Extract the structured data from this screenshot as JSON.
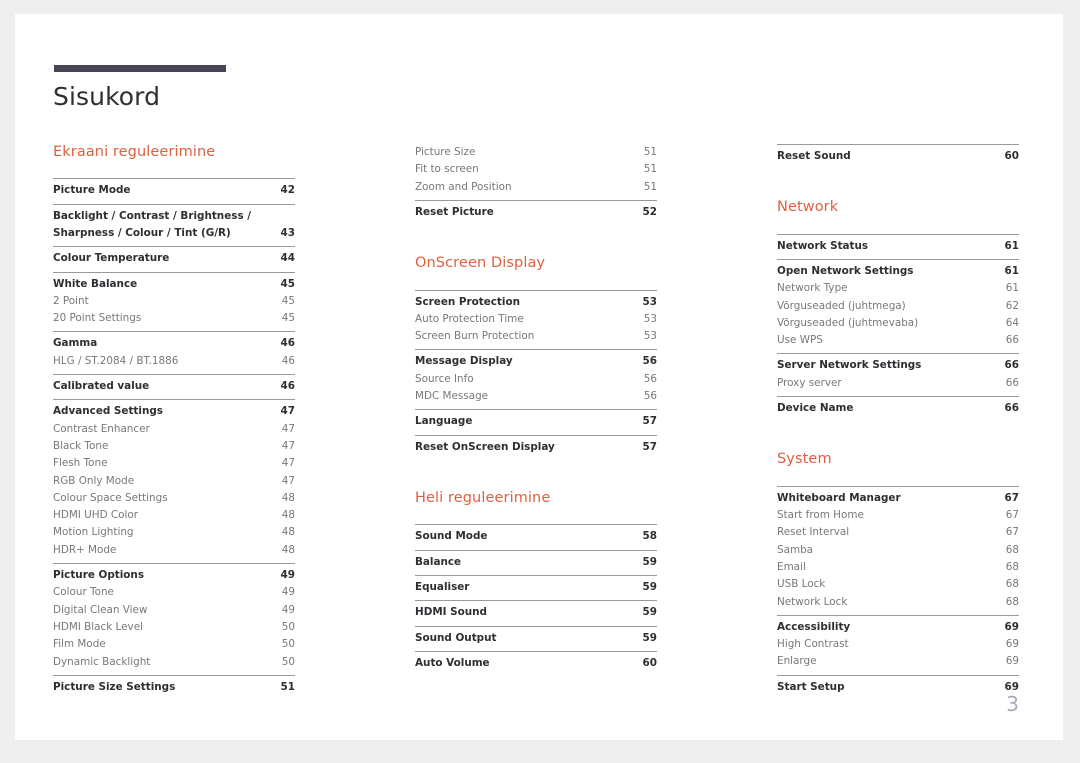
{
  "document": {
    "title": "Sisukord",
    "page_number": "3",
    "accent_color": "#df6040",
    "rule_color": "#474456"
  },
  "columns": [
    {
      "name": "column-1",
      "blocks": [
        {
          "type": "section",
          "heading": "Ekraani reguleerimine"
        },
        {
          "type": "group",
          "rule": true,
          "rows": [
            {
              "label": "Picture Mode",
              "page": "42",
              "level": "main"
            }
          ]
        },
        {
          "type": "group",
          "rule": true,
          "rows": [
            {
              "label": "Backlight / Contrast / Brightness / Sharpness / Colour / Tint (G/R)",
              "page": "43",
              "level": "main",
              "multiline": true
            }
          ]
        },
        {
          "type": "group",
          "rule": true,
          "rows": [
            {
              "label": "Colour Temperature",
              "page": "44",
              "level": "main"
            }
          ]
        },
        {
          "type": "group",
          "rule": true,
          "rows": [
            {
              "label": "White Balance",
              "page": "45",
              "level": "main"
            },
            {
              "label": "2 Point",
              "page": "45",
              "level": "sub"
            },
            {
              "label": "20 Point Settings",
              "page": "45",
              "level": "sub"
            }
          ]
        },
        {
          "type": "group",
          "rule": true,
          "rows": [
            {
              "label": "Gamma",
              "page": "46",
              "level": "main"
            },
            {
              "label": "HLG / ST.2084 / BT.1886",
              "page": "46",
              "level": "sub"
            }
          ]
        },
        {
          "type": "group",
          "rule": true,
          "rows": [
            {
              "label": "Calibrated value",
              "page": "46",
              "level": "main"
            }
          ]
        },
        {
          "type": "group",
          "rule": true,
          "rows": [
            {
              "label": "Advanced Settings",
              "page": "47",
              "level": "main"
            },
            {
              "label": "Contrast Enhancer",
              "page": "47",
              "level": "sub"
            },
            {
              "label": "Black Tone",
              "page": "47",
              "level": "sub"
            },
            {
              "label": "Flesh Tone",
              "page": "47",
              "level": "sub"
            },
            {
              "label": "RGB Only Mode",
              "page": "47",
              "level": "sub"
            },
            {
              "label": "Colour Space Settings",
              "page": "48",
              "level": "sub"
            },
            {
              "label": "HDMI UHD Color",
              "page": "48",
              "level": "sub"
            },
            {
              "label": "Motion Lighting",
              "page": "48",
              "level": "sub"
            },
            {
              "label": "HDR+ Mode",
              "page": "48",
              "level": "sub"
            }
          ]
        },
        {
          "type": "group",
          "rule": true,
          "rows": [
            {
              "label": "Picture Options",
              "page": "49",
              "level": "main"
            },
            {
              "label": "Colour Tone",
              "page": "49",
              "level": "sub"
            },
            {
              "label": "Digital Clean View",
              "page": "49",
              "level": "sub"
            },
            {
              "label": "HDMI Black Level",
              "page": "50",
              "level": "sub"
            },
            {
              "label": "Film Mode",
              "page": "50",
              "level": "sub"
            },
            {
              "label": "Dynamic Backlight",
              "page": "50",
              "level": "sub"
            }
          ]
        },
        {
          "type": "group",
          "rule": true,
          "rows": [
            {
              "label": "Picture Size Settings",
              "page": "51",
              "level": "main"
            }
          ]
        }
      ]
    },
    {
      "name": "column-2",
      "blocks": [
        {
          "type": "group",
          "rule": false,
          "rows": [
            {
              "label": "Picture Size",
              "page": "51",
              "level": "sub"
            },
            {
              "label": "Fit to screen",
              "page": "51",
              "level": "sub"
            },
            {
              "label": "Zoom and Position",
              "page": "51",
              "level": "sub"
            }
          ]
        },
        {
          "type": "group",
          "rule": true,
          "rows": [
            {
              "label": "Reset Picture",
              "page": "52",
              "level": "main"
            }
          ]
        },
        {
          "type": "section",
          "heading": "OnScreen Display"
        },
        {
          "type": "group",
          "rule": true,
          "rows": [
            {
              "label": "Screen Protection",
              "page": "53",
              "level": "main"
            },
            {
              "label": "Auto Protection Time",
              "page": "53",
              "level": "sub"
            },
            {
              "label": "Screen Burn Protection",
              "page": "53",
              "level": "sub"
            }
          ]
        },
        {
          "type": "group",
          "rule": true,
          "rows": [
            {
              "label": "Message Display",
              "page": "56",
              "level": "main"
            },
            {
              "label": "Source Info",
              "page": "56",
              "level": "sub"
            },
            {
              "label": "MDC Message",
              "page": "56",
              "level": "sub"
            }
          ]
        },
        {
          "type": "group",
          "rule": true,
          "rows": [
            {
              "label": "Language",
              "page": "57",
              "level": "main"
            }
          ]
        },
        {
          "type": "group",
          "rule": true,
          "rows": [
            {
              "label": "Reset OnScreen Display",
              "page": "57",
              "level": "main"
            }
          ]
        },
        {
          "type": "section",
          "heading": "Heli reguleerimine"
        },
        {
          "type": "group",
          "rule": true,
          "rows": [
            {
              "label": "Sound Mode",
              "page": "58",
              "level": "main"
            }
          ]
        },
        {
          "type": "group",
          "rule": true,
          "rows": [
            {
              "label": "Balance",
              "page": "59",
              "level": "main"
            }
          ]
        },
        {
          "type": "group",
          "rule": true,
          "rows": [
            {
              "label": "Equaliser",
              "page": "59",
              "level": "main"
            }
          ]
        },
        {
          "type": "group",
          "rule": true,
          "rows": [
            {
              "label": "HDMI Sound",
              "page": "59",
              "level": "main"
            }
          ]
        },
        {
          "type": "group",
          "rule": true,
          "rows": [
            {
              "label": "Sound Output",
              "page": "59",
              "level": "main"
            }
          ]
        },
        {
          "type": "group",
          "rule": true,
          "rows": [
            {
              "label": "Auto Volume",
              "page": "60",
              "level": "main"
            }
          ]
        }
      ]
    },
    {
      "name": "column-3",
      "blocks": [
        {
          "type": "group",
          "rule": true,
          "rows": [
            {
              "label": "Reset Sound",
              "page": "60",
              "level": "main"
            }
          ]
        },
        {
          "type": "section",
          "heading": "Network"
        },
        {
          "type": "group",
          "rule": true,
          "rows": [
            {
              "label": "Network Status",
              "page": "61",
              "level": "main"
            }
          ]
        },
        {
          "type": "group",
          "rule": true,
          "rows": [
            {
              "label": "Open Network Settings",
              "page": "61",
              "level": "main"
            },
            {
              "label": "Network Type",
              "page": "61",
              "level": "sub"
            },
            {
              "label": "Võrguseaded (juhtmega)",
              "page": "62",
              "level": "sub"
            },
            {
              "label": "Võrguseaded (juhtmevaba)",
              "page": "64",
              "level": "sub"
            },
            {
              "label": "Use WPS",
              "page": "66",
              "level": "sub"
            }
          ]
        },
        {
          "type": "group",
          "rule": true,
          "rows": [
            {
              "label": "Server Network Settings",
              "page": "66",
              "level": "main"
            },
            {
              "label": "Proxy server",
              "page": "66",
              "level": "sub"
            }
          ]
        },
        {
          "type": "group",
          "rule": true,
          "rows": [
            {
              "label": "Device Name",
              "page": "66",
              "level": "main"
            }
          ]
        },
        {
          "type": "section",
          "heading": "System"
        },
        {
          "type": "group",
          "rule": true,
          "rows": [
            {
              "label": "Whiteboard Manager",
              "page": "67",
              "level": "main"
            },
            {
              "label": "Start from Home",
              "page": "67",
              "level": "sub"
            },
            {
              "label": "Reset Interval",
              "page": "67",
              "level": "sub"
            },
            {
              "label": "Samba",
              "page": "68",
              "level": "sub"
            },
            {
              "label": "Email",
              "page": "68",
              "level": "sub"
            },
            {
              "label": "USB Lock",
              "page": "68",
              "level": "sub"
            },
            {
              "label": "Network Lock",
              "page": "68",
              "level": "sub"
            }
          ]
        },
        {
          "type": "group",
          "rule": true,
          "rows": [
            {
              "label": "Accessibility",
              "page": "69",
              "level": "main"
            },
            {
              "label": "High Contrast",
              "page": "69",
              "level": "sub"
            },
            {
              "label": "Enlarge",
              "page": "69",
              "level": "sub"
            }
          ]
        },
        {
          "type": "group",
          "rule": true,
          "rows": [
            {
              "label": "Start Setup",
              "page": "69",
              "level": "main"
            }
          ]
        }
      ]
    }
  ]
}
